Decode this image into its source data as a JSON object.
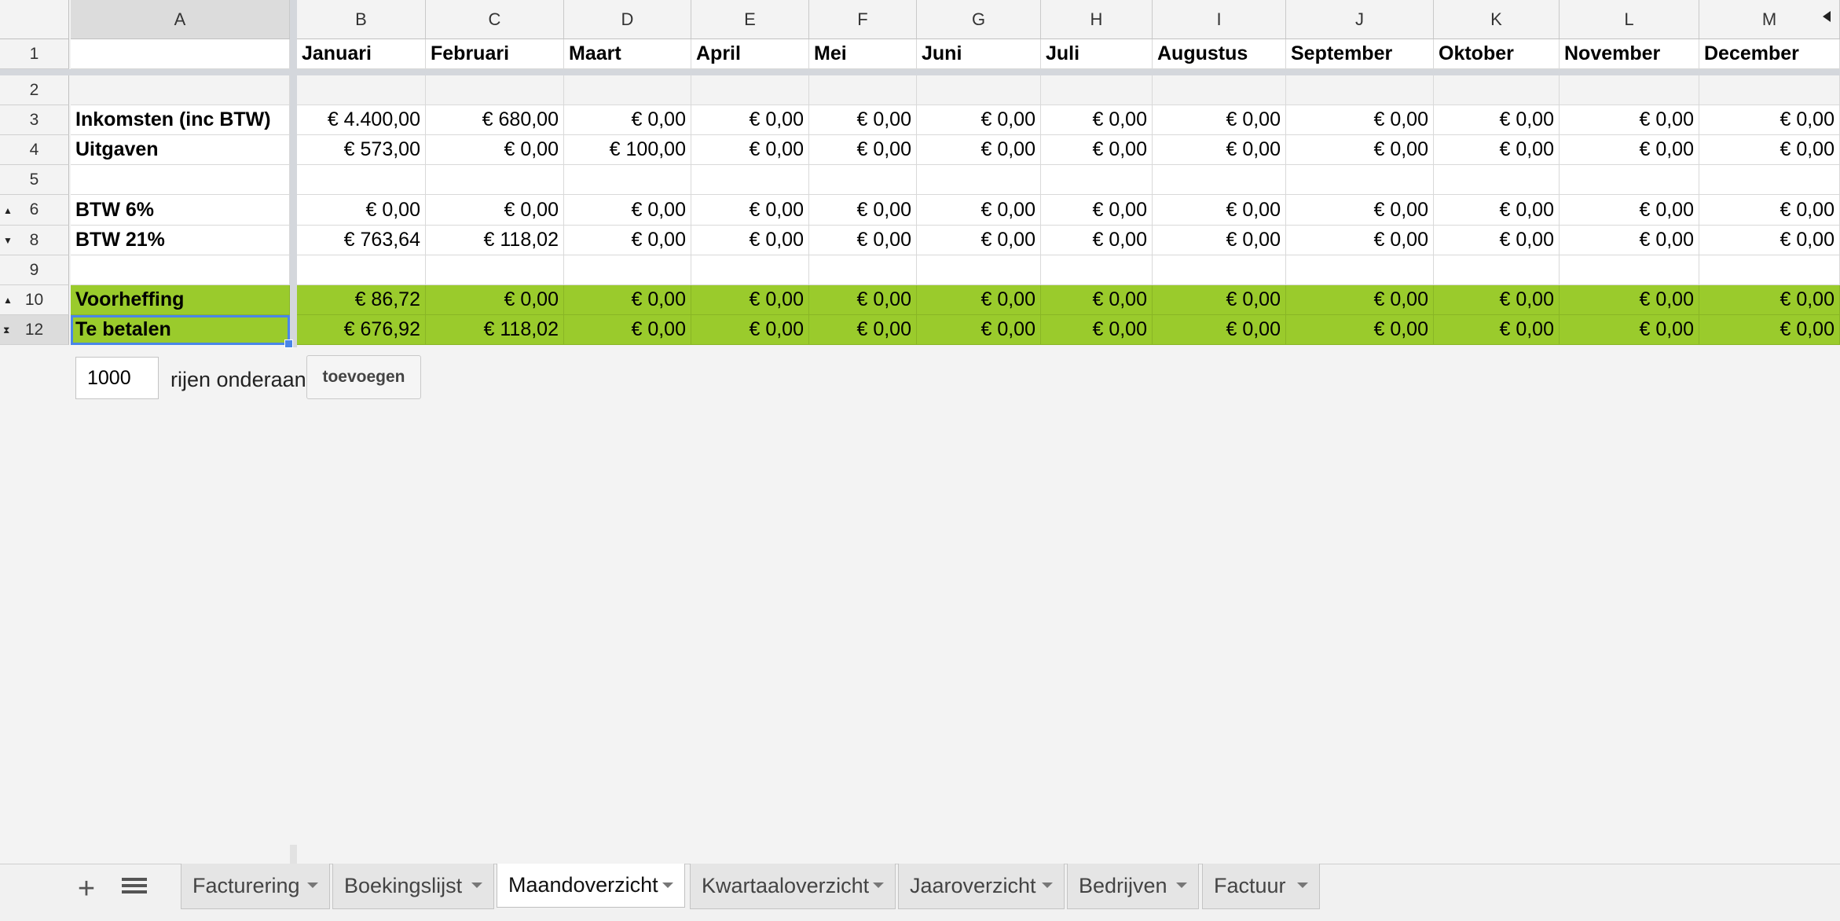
{
  "columns": [
    "A",
    "B",
    "C",
    "D",
    "E",
    "F",
    "G",
    "H",
    "I",
    "J",
    "K",
    "L",
    "M"
  ],
  "months": [
    "Januari",
    "Februari",
    "Maart",
    "April",
    "Mei",
    "Juni",
    "Juli",
    "Augustus",
    "September",
    "Oktober",
    "November",
    "December"
  ],
  "rows": [
    {
      "num": "1"
    },
    {
      "num": "2"
    },
    {
      "num": "3",
      "label": "Inkomsten (inc BTW)",
      "values": [
        "€ 4.400,00",
        "€ 680,00",
        "€ 0,00",
        "€ 0,00",
        "€ 0,00",
        "€ 0,00",
        "€ 0,00",
        "€ 0,00",
        "€ 0,00",
        "€ 0,00",
        "€ 0,00",
        "€ 0,00"
      ]
    },
    {
      "num": "4",
      "label": "Uitgaven",
      "values": [
        "€ 573,00",
        "€ 0,00",
        "€ 100,00",
        "€ 0,00",
        "€ 0,00",
        "€ 0,00",
        "€ 0,00",
        "€ 0,00",
        "€ 0,00",
        "€ 0,00",
        "€ 0,00",
        "€ 0,00"
      ]
    },
    {
      "num": "5"
    },
    {
      "num": "6",
      "label": "BTW 6%",
      "values": [
        "€ 0,00",
        "€ 0,00",
        "€ 0,00",
        "€ 0,00",
        "€ 0,00",
        "€ 0,00",
        "€ 0,00",
        "€ 0,00",
        "€ 0,00",
        "€ 0,00",
        "€ 0,00",
        "€ 0,00"
      ]
    },
    {
      "num": "8",
      "label": "BTW 21%",
      "values": [
        "€ 763,64",
        "€ 118,02",
        "€ 0,00",
        "€ 0,00",
        "€ 0,00",
        "€ 0,00",
        "€ 0,00",
        "€ 0,00",
        "€ 0,00",
        "€ 0,00",
        "€ 0,00",
        "€ 0,00"
      ]
    },
    {
      "num": "9"
    },
    {
      "num": "10",
      "label": "Voorheffing",
      "values": [
        "€ 86,72",
        "€ 0,00",
        "€ 0,00",
        "€ 0,00",
        "€ 0,00",
        "€ 0,00",
        "€ 0,00",
        "€ 0,00",
        "€ 0,00",
        "€ 0,00",
        "€ 0,00",
        "€ 0,00"
      ]
    },
    {
      "num": "12",
      "label": "Te betalen",
      "values": [
        "€ 676,92",
        "€ 118,02",
        "€ 0,00",
        "€ 0,00",
        "€ 0,00",
        "€ 0,00",
        "€ 0,00",
        "€ 0,00",
        "€ 0,00",
        "€ 0,00",
        "€ 0,00",
        "€ 0,00"
      ]
    }
  ],
  "selected_cell": "A12",
  "add_rows": {
    "count": "1000",
    "label": "rijen onderaan",
    "button": "toevoegen"
  },
  "sheets": [
    "Facturering",
    "Boekingslijst",
    "Maandoverzicht",
    "Kwartaaloverzicht",
    "Jaaroverzicht",
    "Bedrijven",
    "Factuur"
  ],
  "active_sheet": "Maandoverzicht",
  "colors": {
    "highlight": "#9acb2c",
    "selection": "#4a86e8"
  },
  "icons": {
    "add_sheet": "plus-icon",
    "all_sheets": "list-icon",
    "tab_menu": "caret-down-icon",
    "scroll": "arrow-left-icon"
  }
}
